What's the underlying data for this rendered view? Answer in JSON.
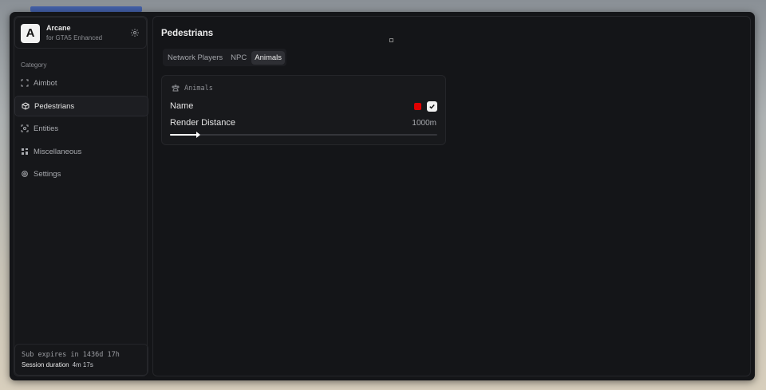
{
  "app": {
    "name": "Arcane",
    "subtitle": "for GTA5 Enhanced",
    "logo_letter": "A"
  },
  "sidebar": {
    "category_label": "Category",
    "items": [
      {
        "label": "Aimbot",
        "icon": "crosshair-icon",
        "active": false
      },
      {
        "label": "Pedestrians",
        "icon": "cube-icon",
        "active": true
      },
      {
        "label": "Entities",
        "icon": "scan-icon",
        "active": false
      },
      {
        "label": "Miscellaneous",
        "icon": "grid-icon",
        "active": false
      },
      {
        "label": "Settings",
        "icon": "gear-icon",
        "active": false
      }
    ]
  },
  "footer": {
    "sub_expires": "Sub expires in 1436d 17h",
    "session_label": "Session duration",
    "session_value": "4m 17s"
  },
  "main": {
    "title": "Pedestrians",
    "tabs": [
      {
        "label": "Network Players",
        "active": false
      },
      {
        "label": "NPC",
        "active": false
      },
      {
        "label": "Animals",
        "active": true
      }
    ],
    "card": {
      "header": "Animals",
      "header_icon": "paw-icon",
      "name_label": "Name",
      "name_color": "#e00000",
      "name_checked": true,
      "render_label": "Render Distance",
      "render_value": "1000m",
      "render_fraction": 0.1
    }
  },
  "colors": {
    "accent": "#ffffff",
    "window_bg": "#141518",
    "swatch": "#e00000"
  }
}
